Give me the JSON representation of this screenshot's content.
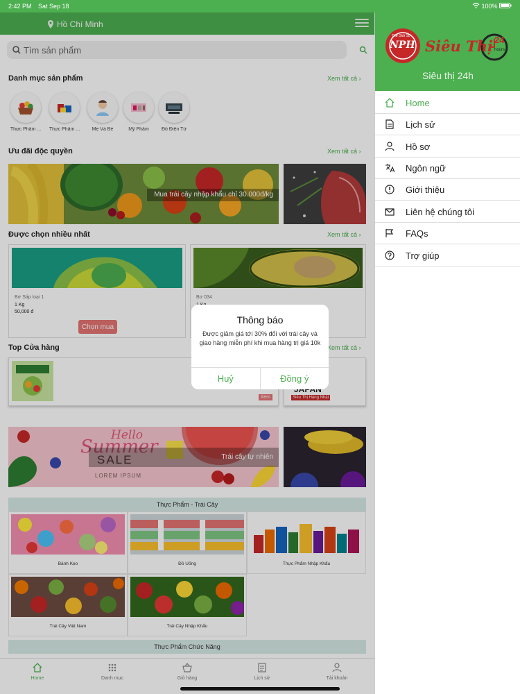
{
  "status": {
    "time": "2:42 PM",
    "date": "Sat Sep 18",
    "battery": "100%"
  },
  "header": {
    "location": "Hồ Chí Minh"
  },
  "search": {
    "placeholder": "Tìm sản phẩm"
  },
  "sections": {
    "categories": "Danh mục sản phẩm",
    "offers": "Ưu đãi độc quyền",
    "popular": "Được chọn nhiều nhất",
    "stores": "Top Cửa hàng",
    "see_all": "Xem tất cả ›"
  },
  "categories": [
    {
      "label": "Thực Phẩm ...",
      "icon": "fruit-basket-icon"
    },
    {
      "label": "Thực Phẩm ...",
      "icon": "groceries-icon"
    },
    {
      "label": "Mẹ Và Bé",
      "icon": "baby-icon"
    },
    {
      "label": "Mỹ Phẩm",
      "icon": "cosmetics-icon"
    },
    {
      "label": "Đồ Điện Tử",
      "icon": "electronics-icon"
    }
  ],
  "offer_banner": {
    "caption": "Mua trái cây nhập khẩu chỉ 30.000đ/kg"
  },
  "products": [
    {
      "name": "Bơ Sáp loại 1",
      "qty": "1 Kg",
      "price": "50,000 đ",
      "button": "Chọn mua"
    },
    {
      "name": "Bơ 034",
      "qty": "1 Kg"
    }
  ],
  "store": {
    "label": "Xem",
    "japan_text": "JAPAN",
    "japan_sub": "Siêu Thị Hàng Nhật",
    "hours": "07:00 AM - 07:00 PM"
  },
  "summer_banner": {
    "title": "Hello",
    "title2": "Summer",
    "sale": "SALE",
    "lorem": "LOREM IPSUM",
    "caption": "Trái cây tự nhiên"
  },
  "group1": {
    "title": "Thực Phẩm - Trái Cây",
    "tiles": [
      "Bánh Kẹo",
      "Đồ Uống",
      "Thực Phẩm Nhập Khẩu",
      "Trái Cây Việt Nam",
      "Trái Cây Nhập Khẩu"
    ]
  },
  "group2": {
    "title": "Thực Phẩm Chức Năng"
  },
  "tabs": [
    "Home",
    "Danh mục",
    "Giỏ hàng",
    "Lịch sử",
    "Tài khoản"
  ],
  "dialog": {
    "title": "Thông báo",
    "message": "Được giảm giá tới 30% đối với trái cây và giao hàng miễn phí khi mua hàng trị giá 10k",
    "cancel": "Huỷ",
    "ok": "Đồng ý"
  },
  "drawer": {
    "logo_text": "Siêu Thị",
    "logo_badge": "NPH",
    "logo_small": "Thế Giới Số",
    "logo_24": "24",
    "logo_hours": "hours",
    "name": "Siêu thị 24h",
    "items": [
      {
        "label": "Home",
        "icon": "home-icon"
      },
      {
        "label": "Lịch sử",
        "icon": "document-icon"
      },
      {
        "label": "Hồ sơ",
        "icon": "user-icon"
      },
      {
        "label": "Ngôn ngữ",
        "icon": "translate-icon"
      },
      {
        "label": "Giới thiệu",
        "icon": "info-icon"
      },
      {
        "label": "Liên hệ chúng tôi",
        "icon": "mail-icon"
      },
      {
        "label": "FAQs",
        "icon": "flag-icon"
      },
      {
        "label": "Trợ giúp",
        "icon": "help-icon"
      }
    ]
  },
  "colors": {
    "primary": "#4caf50",
    "buy_button": "#e57373",
    "group_header": "#d6e9e6"
  }
}
